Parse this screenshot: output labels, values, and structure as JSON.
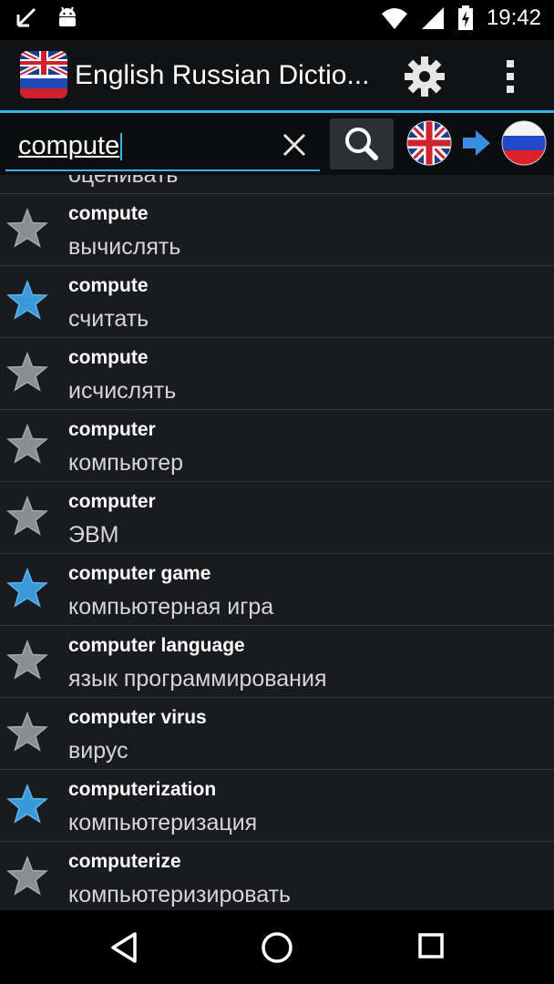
{
  "status_bar": {
    "time": "19:42",
    "icons": [
      "missed-call-icon",
      "android-icon",
      "wifi-icon",
      "signal-icon",
      "battery-charging-icon"
    ]
  },
  "app_bar": {
    "title": "English Russian Dictio...",
    "icons": [
      "app-flag-icon",
      "gear-icon",
      "overflow-menu-icon"
    ]
  },
  "search": {
    "query": "compute",
    "icons": [
      "clear-icon",
      "search-icon",
      "uk-flag-icon",
      "arrow-right-icon",
      "russia-flag-icon"
    ]
  },
  "results": {
    "partial_top": "оценивать",
    "items": [
      {
        "word": "compute",
        "translation": "вычислять",
        "favorite": false
      },
      {
        "word": "compute",
        "translation": "считать",
        "favorite": true
      },
      {
        "word": "compute",
        "translation": "исчислять",
        "favorite": false
      },
      {
        "word": "computer",
        "translation": "компьютер",
        "favorite": false
      },
      {
        "word": "computer",
        "translation": "ЭВМ",
        "favorite": false
      },
      {
        "word": "computer game",
        "translation": "компьютерная игра",
        "favorite": true
      },
      {
        "word": "computer language",
        "translation": "язык программирования",
        "favorite": false
      },
      {
        "word": "computer virus",
        "translation": "вирус",
        "favorite": false
      },
      {
        "word": "computerization",
        "translation": "компьютеризация",
        "favorite": true
      },
      {
        "word": "computerize",
        "translation": "компьютеризировать",
        "favorite": false
      }
    ]
  },
  "colors": {
    "accent": "#33b5e5",
    "star_favorite": "#3a9ad9",
    "star_default": "#8a8d91"
  },
  "nav_bar": {
    "icons": [
      "back-icon",
      "home-icon",
      "recents-icon"
    ]
  }
}
